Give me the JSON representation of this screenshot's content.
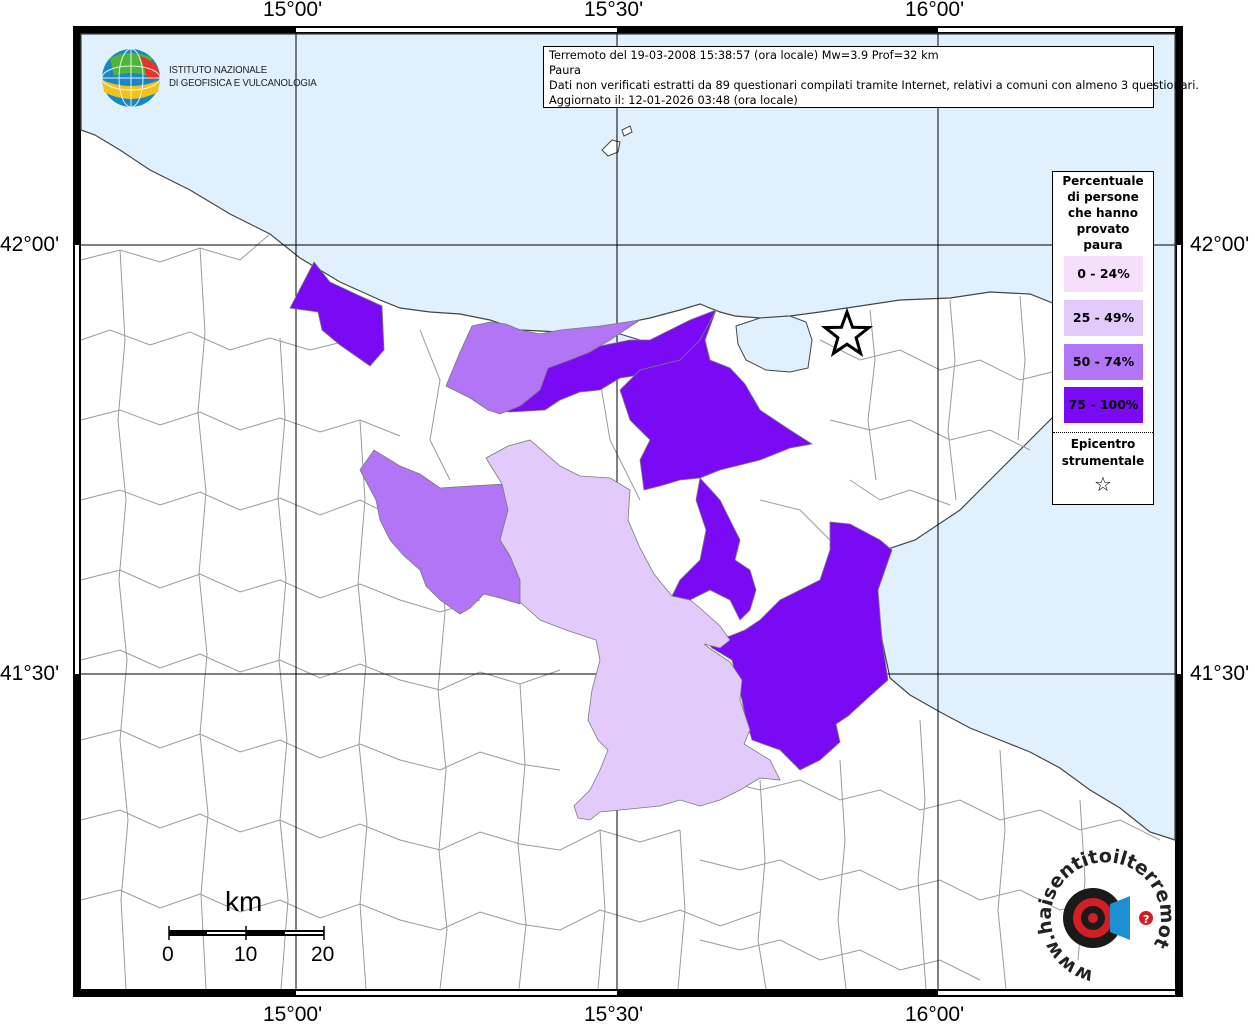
{
  "header": {
    "line1": "Terremoto del 19-03-2008 15:38:57 (ora locale) Mw=3.9 Prof=32 km",
    "line2": "Paura",
    "line3": "Dati non verificati estratti da 89 questionari compilati tramite Internet, relativi a comuni con almeno 3 questionari.",
    "line4": "Aggiornato il: 12-01-2026 03:48 (ora locale)"
  },
  "institute": {
    "line1": "ISTITUTO NAZIONALE",
    "line2": "DI GEOFISICA E VULCANOLOGIA"
  },
  "coordinates": {
    "lon_top": [
      "15°00'",
      "15°30'",
      "16°00'"
    ],
    "lon_bottom": [
      "15°00'",
      "15°30'",
      "16°00'"
    ],
    "lat_left": [
      "42°00'",
      "41°30'"
    ],
    "lat_right": [
      "42°00'",
      "41°30'"
    ]
  },
  "legend": {
    "title": [
      "Percentuale",
      "di persone",
      "che hanno",
      "provato",
      "paura"
    ],
    "classes": [
      {
        "label": "0 - 24%",
        "color": "#f6dffb"
      },
      {
        "label": "25 - 49%",
        "color": "#e2cbfb"
      },
      {
        "label": "50 - 74%",
        "color": "#b175f5"
      },
      {
        "label": "75 - 100%",
        "color": "#7a09f4"
      }
    ],
    "epicenter_label": [
      "Epicentro",
      "strumentale"
    ],
    "epicenter_symbol": "☆"
  },
  "scale": {
    "unit": "km",
    "ticks": [
      "0",
      "10",
      "20"
    ]
  },
  "watermark": {
    "text": "www.haisentitoilterremoto.it"
  },
  "colors": {
    "sea": "#e0f1fd",
    "land": "#ffffff",
    "borders": "#9a9a9a"
  }
}
